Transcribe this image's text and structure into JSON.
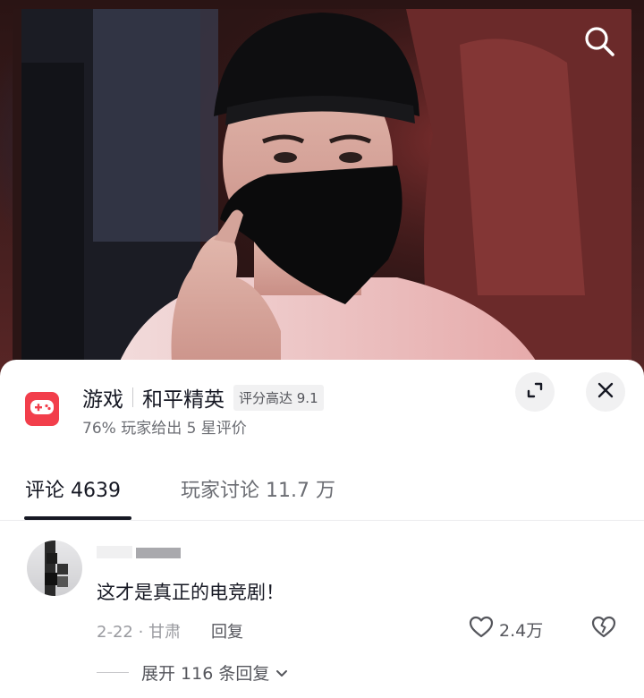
{
  "video": {
    "search_icon": "search-icon"
  },
  "game": {
    "icon": "gamepad-icon",
    "category": "游戏",
    "name": "和平精英",
    "rating_badge": "评分高达 9.1",
    "subtitle": "76% 玩家给出 5 星评价"
  },
  "tabs": {
    "comments": "评论 4639",
    "discussion": "玩家讨论 11.7 万"
  },
  "comment": {
    "text": "这才是真正的电竞剧！",
    "meta": "2-22 · 甘肃",
    "reply_label": "回复",
    "like_count": "2.4万",
    "expand_label": "展开 116 条回复"
  },
  "colors": {
    "accent": "#f23e4b",
    "text_primary": "#161823",
    "text_secondary": "#6b6d73"
  }
}
